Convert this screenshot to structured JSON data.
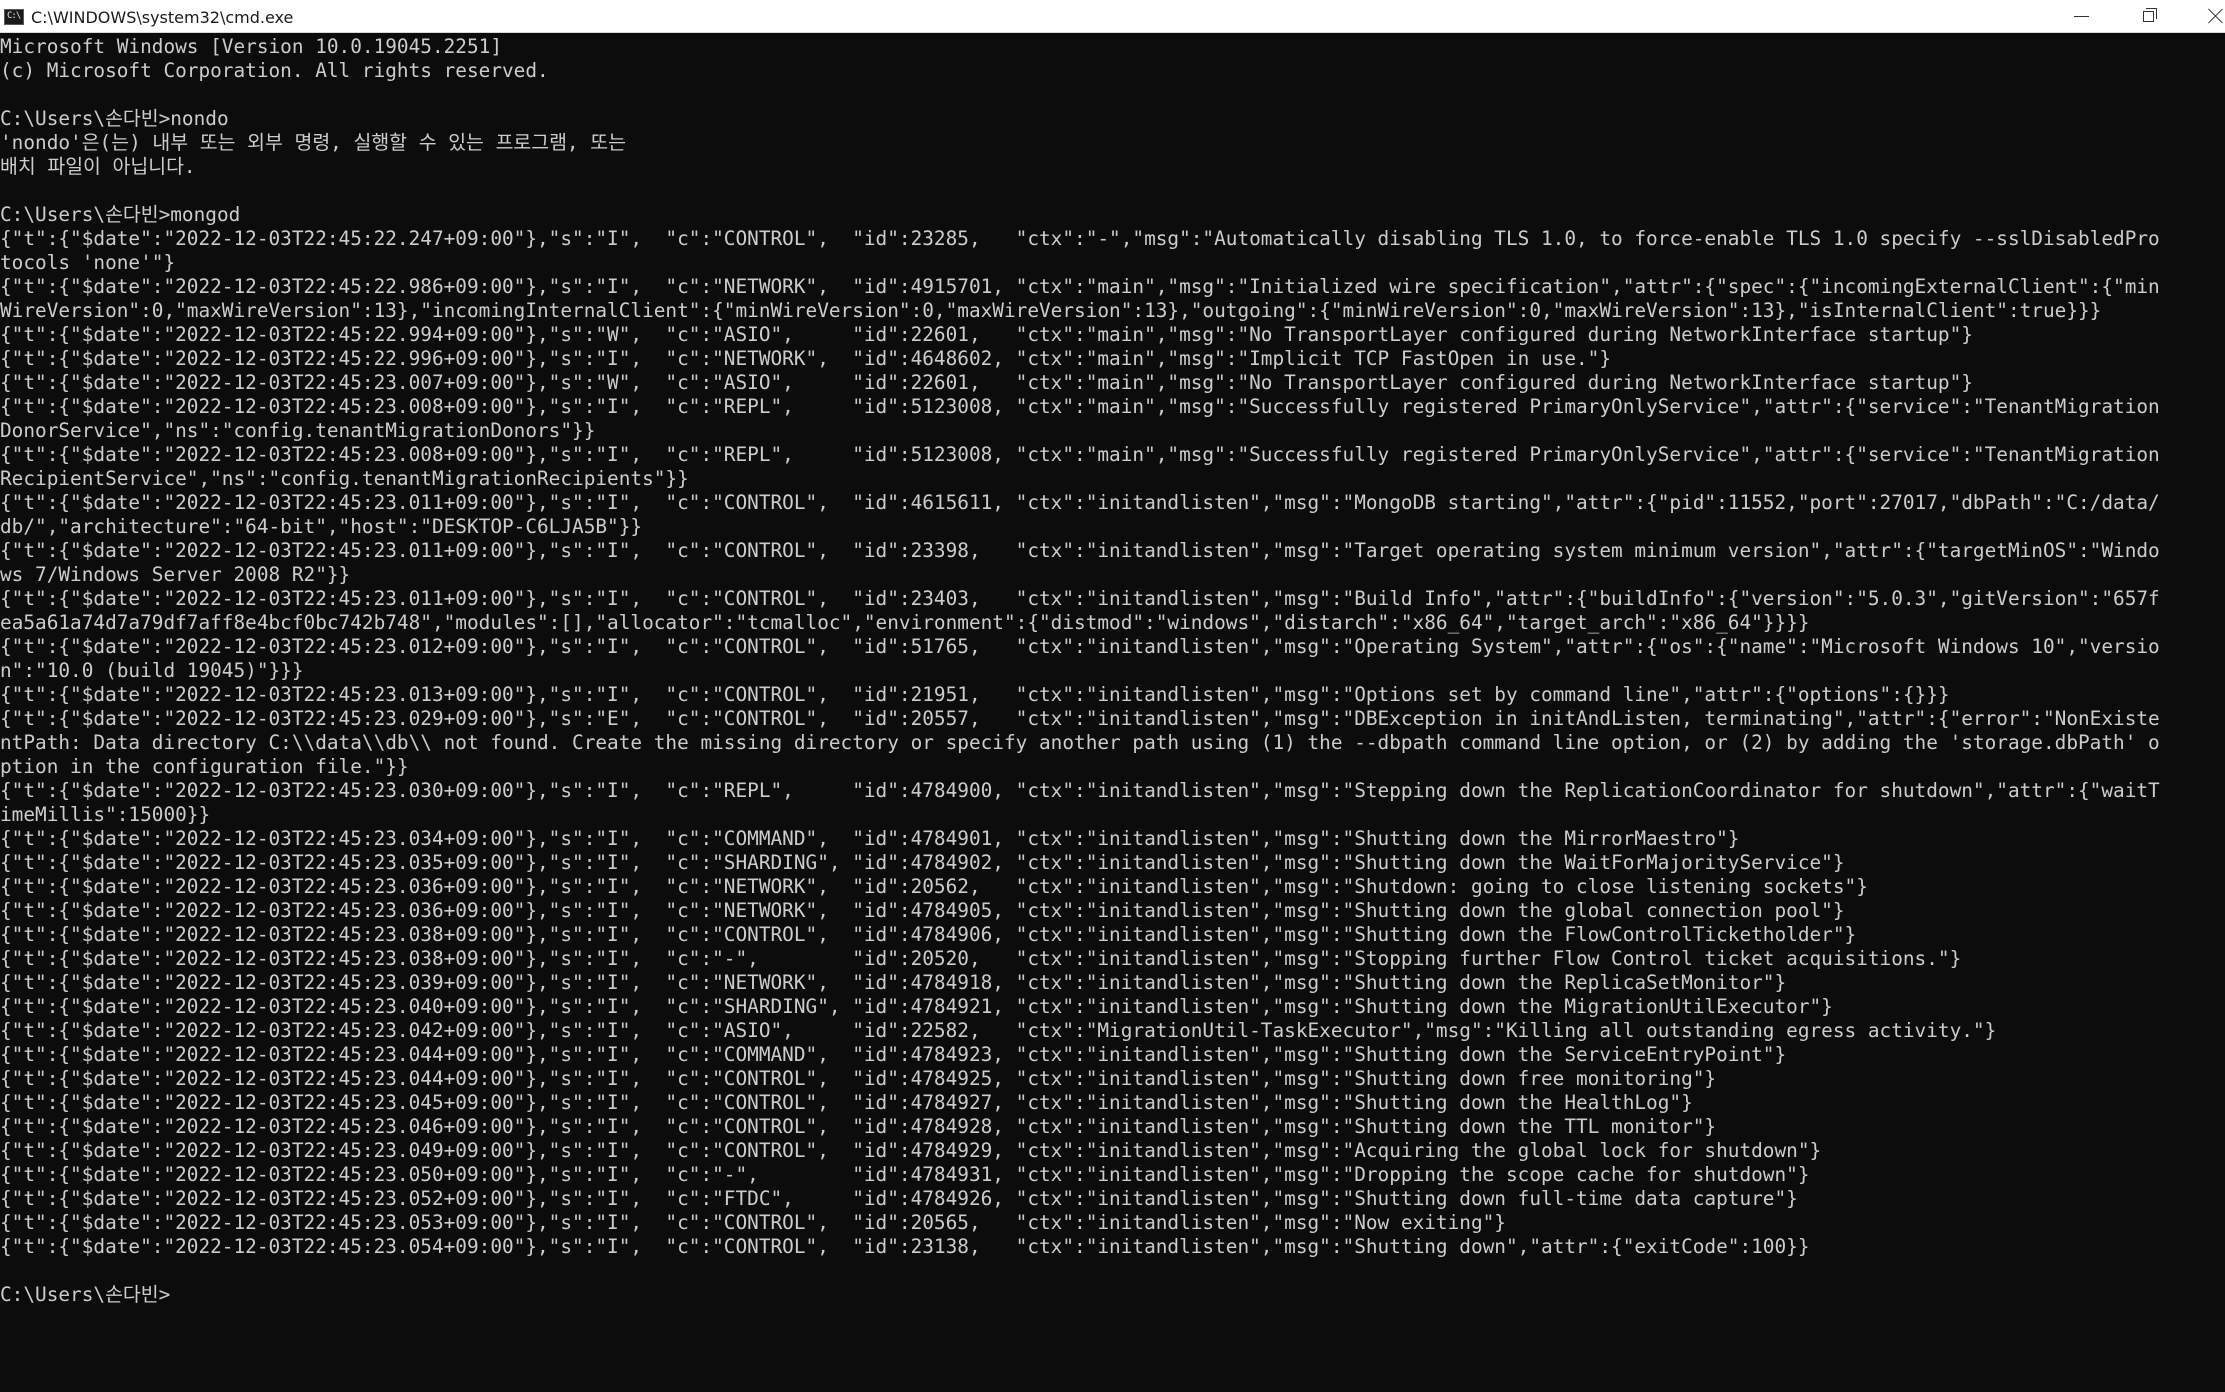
{
  "window": {
    "title": "C:\\WINDOWS\\system32\\cmd.exe",
    "icon_text": "C:\\"
  },
  "controls": {
    "minimize_icon": "minimize-icon",
    "maximize_icon": "restore-icon",
    "close_icon": "close-icon"
  },
  "colors": {
    "background": "#0c0c0c",
    "text": "#cccccc",
    "titlebar": "#ffffff"
  },
  "console": {
    "lines": [
      "Microsoft Windows [Version 10.0.19045.2251]",
      "(c) Microsoft Corporation. All rights reserved.",
      "",
      "C:\\Users\\손다빈>nondo",
      "'nondo'은(는) 내부 또는 외부 명령, 실행할 수 있는 프로그램, 또는",
      "배치 파일이 아닙니다.",
      "",
      "C:\\Users\\손다빈>mongod",
      "{\"t\":{\"$date\":\"2022-12-03T22:45:22.247+09:00\"},\"s\":\"I\",  \"c\":\"CONTROL\",  \"id\":23285,   \"ctx\":\"-\",\"msg\":\"Automatically disabling TLS 1.0, to force-enable TLS 1.0 specify --sslDisabledPro",
      "tocols 'none'\"}",
      "{\"t\":{\"$date\":\"2022-12-03T22:45:22.986+09:00\"},\"s\":\"I\",  \"c\":\"NETWORK\",  \"id\":4915701, \"ctx\":\"main\",\"msg\":\"Initialized wire specification\",\"attr\":{\"spec\":{\"incomingExternalClient\":{\"min",
      "WireVersion\":0,\"maxWireVersion\":13},\"incomingInternalClient\":{\"minWireVersion\":0,\"maxWireVersion\":13},\"outgoing\":{\"minWireVersion\":0,\"maxWireVersion\":13},\"isInternalClient\":true}}}",
      "{\"t\":{\"$date\":\"2022-12-03T22:45:22.994+09:00\"},\"s\":\"W\",  \"c\":\"ASIO\",     \"id\":22601,   \"ctx\":\"main\",\"msg\":\"No TransportLayer configured during NetworkInterface startup\"}",
      "{\"t\":{\"$date\":\"2022-12-03T22:45:22.996+09:00\"},\"s\":\"I\",  \"c\":\"NETWORK\",  \"id\":4648602, \"ctx\":\"main\",\"msg\":\"Implicit TCP FastOpen in use.\"}",
      "{\"t\":{\"$date\":\"2022-12-03T22:45:23.007+09:00\"},\"s\":\"W\",  \"c\":\"ASIO\",     \"id\":22601,   \"ctx\":\"main\",\"msg\":\"No TransportLayer configured during NetworkInterface startup\"}",
      "{\"t\":{\"$date\":\"2022-12-03T22:45:23.008+09:00\"},\"s\":\"I\",  \"c\":\"REPL\",     \"id\":5123008, \"ctx\":\"main\",\"msg\":\"Successfully registered PrimaryOnlyService\",\"attr\":{\"service\":\"TenantMigration",
      "DonorService\",\"ns\":\"config.tenantMigrationDonors\"}}",
      "{\"t\":{\"$date\":\"2022-12-03T22:45:23.008+09:00\"},\"s\":\"I\",  \"c\":\"REPL\",     \"id\":5123008, \"ctx\":\"main\",\"msg\":\"Successfully registered PrimaryOnlyService\",\"attr\":{\"service\":\"TenantMigration",
      "RecipientService\",\"ns\":\"config.tenantMigrationRecipients\"}}",
      "{\"t\":{\"$date\":\"2022-12-03T22:45:23.011+09:00\"},\"s\":\"I\",  \"c\":\"CONTROL\",  \"id\":4615611, \"ctx\":\"initandlisten\",\"msg\":\"MongoDB starting\",\"attr\":{\"pid\":11552,\"port\":27017,\"dbPath\":\"C:/data/",
      "db/\",\"architecture\":\"64-bit\",\"host\":\"DESKTOP-C6LJA5B\"}}",
      "{\"t\":{\"$date\":\"2022-12-03T22:45:23.011+09:00\"},\"s\":\"I\",  \"c\":\"CONTROL\",  \"id\":23398,   \"ctx\":\"initandlisten\",\"msg\":\"Target operating system minimum version\",\"attr\":{\"targetMinOS\":\"Windo",
      "ws 7/Windows Server 2008 R2\"}}",
      "{\"t\":{\"$date\":\"2022-12-03T22:45:23.011+09:00\"},\"s\":\"I\",  \"c\":\"CONTROL\",  \"id\":23403,   \"ctx\":\"initandlisten\",\"msg\":\"Build Info\",\"attr\":{\"buildInfo\":{\"version\":\"5.0.3\",\"gitVersion\":\"657f",
      "ea5a61a74d7a79df7aff8e4bcf0bc742b748\",\"modules\":[],\"allocator\":\"tcmalloc\",\"environment\":{\"distmod\":\"windows\",\"distarch\":\"x86_64\",\"target_arch\":\"x86_64\"}}}}",
      "{\"t\":{\"$date\":\"2022-12-03T22:45:23.012+09:00\"},\"s\":\"I\",  \"c\":\"CONTROL\",  \"id\":51765,   \"ctx\":\"initandlisten\",\"msg\":\"Operating System\",\"attr\":{\"os\":{\"name\":\"Microsoft Windows 10\",\"versio",
      "n\":\"10.0 (build 19045)\"}}}",
      "{\"t\":{\"$date\":\"2022-12-03T22:45:23.013+09:00\"},\"s\":\"I\",  \"c\":\"CONTROL\",  \"id\":21951,   \"ctx\":\"initandlisten\",\"msg\":\"Options set by command line\",\"attr\":{\"options\":{}}}",
      "{\"t\":{\"$date\":\"2022-12-03T22:45:23.029+09:00\"},\"s\":\"E\",  \"c\":\"CONTROL\",  \"id\":20557,   \"ctx\":\"initandlisten\",\"msg\":\"DBException in initAndListen, terminating\",\"attr\":{\"error\":\"NonExiste",
      "ntPath: Data directory C:\\\\data\\\\db\\\\ not found. Create the missing directory or specify another path using (1) the --dbpath command line option, or (2) by adding the 'storage.dbPath' o",
      "ption in the configuration file.\"}}",
      "{\"t\":{\"$date\":\"2022-12-03T22:45:23.030+09:00\"},\"s\":\"I\",  \"c\":\"REPL\",     \"id\":4784900, \"ctx\":\"initandlisten\",\"msg\":\"Stepping down the ReplicationCoordinator for shutdown\",\"attr\":{\"waitT",
      "imeMillis\":15000}}",
      "{\"t\":{\"$date\":\"2022-12-03T22:45:23.034+09:00\"},\"s\":\"I\",  \"c\":\"COMMAND\",  \"id\":4784901, \"ctx\":\"initandlisten\",\"msg\":\"Shutting down the MirrorMaestro\"}",
      "{\"t\":{\"$date\":\"2022-12-03T22:45:23.035+09:00\"},\"s\":\"I\",  \"c\":\"SHARDING\", \"id\":4784902, \"ctx\":\"initandlisten\",\"msg\":\"Shutting down the WaitForMajorityService\"}",
      "{\"t\":{\"$date\":\"2022-12-03T22:45:23.036+09:00\"},\"s\":\"I\",  \"c\":\"NETWORK\",  \"id\":20562,   \"ctx\":\"initandlisten\",\"msg\":\"Shutdown: going to close listening sockets\"}",
      "{\"t\":{\"$date\":\"2022-12-03T22:45:23.036+09:00\"},\"s\":\"I\",  \"c\":\"NETWORK\",  \"id\":4784905, \"ctx\":\"initandlisten\",\"msg\":\"Shutting down the global connection pool\"}",
      "{\"t\":{\"$date\":\"2022-12-03T22:45:23.038+09:00\"},\"s\":\"I\",  \"c\":\"CONTROL\",  \"id\":4784906, \"ctx\":\"initandlisten\",\"msg\":\"Shutting down the FlowControlTicketholder\"}",
      "{\"t\":{\"$date\":\"2022-12-03T22:45:23.038+09:00\"},\"s\":\"I\",  \"c\":\"-\",        \"id\":20520,   \"ctx\":\"initandlisten\",\"msg\":\"Stopping further Flow Control ticket acquisitions.\"}",
      "{\"t\":{\"$date\":\"2022-12-03T22:45:23.039+09:00\"},\"s\":\"I\",  \"c\":\"NETWORK\",  \"id\":4784918, \"ctx\":\"initandlisten\",\"msg\":\"Shutting down the ReplicaSetMonitor\"}",
      "{\"t\":{\"$date\":\"2022-12-03T22:45:23.040+09:00\"},\"s\":\"I\",  \"c\":\"SHARDING\", \"id\":4784921, \"ctx\":\"initandlisten\",\"msg\":\"Shutting down the MigrationUtilExecutor\"}",
      "{\"t\":{\"$date\":\"2022-12-03T22:45:23.042+09:00\"},\"s\":\"I\",  \"c\":\"ASIO\",     \"id\":22582,   \"ctx\":\"MigrationUtil-TaskExecutor\",\"msg\":\"Killing all outstanding egress activity.\"}",
      "{\"t\":{\"$date\":\"2022-12-03T22:45:23.044+09:00\"},\"s\":\"I\",  \"c\":\"COMMAND\",  \"id\":4784923, \"ctx\":\"initandlisten\",\"msg\":\"Shutting down the ServiceEntryPoint\"}",
      "{\"t\":{\"$date\":\"2022-12-03T22:45:23.044+09:00\"},\"s\":\"I\",  \"c\":\"CONTROL\",  \"id\":4784925, \"ctx\":\"initandlisten\",\"msg\":\"Shutting down free monitoring\"}",
      "{\"t\":{\"$date\":\"2022-12-03T22:45:23.045+09:00\"},\"s\":\"I\",  \"c\":\"CONTROL\",  \"id\":4784927, \"ctx\":\"initandlisten\",\"msg\":\"Shutting down the HealthLog\"}",
      "{\"t\":{\"$date\":\"2022-12-03T22:45:23.046+09:00\"},\"s\":\"I\",  \"c\":\"CONTROL\",  \"id\":4784928, \"ctx\":\"initandlisten\",\"msg\":\"Shutting down the TTL monitor\"}",
      "{\"t\":{\"$date\":\"2022-12-03T22:45:23.049+09:00\"},\"s\":\"I\",  \"c\":\"CONTROL\",  \"id\":4784929, \"ctx\":\"initandlisten\",\"msg\":\"Acquiring the global lock for shutdown\"}",
      "{\"t\":{\"$date\":\"2022-12-03T22:45:23.050+09:00\"},\"s\":\"I\",  \"c\":\"-\",        \"id\":4784931, \"ctx\":\"initandlisten\",\"msg\":\"Dropping the scope cache for shutdown\"}",
      "{\"t\":{\"$date\":\"2022-12-03T22:45:23.052+09:00\"},\"s\":\"I\",  \"c\":\"FTDC\",     \"id\":4784926, \"ctx\":\"initandlisten\",\"msg\":\"Shutting down full-time data capture\"}",
      "{\"t\":{\"$date\":\"2022-12-03T22:45:23.053+09:00\"},\"s\":\"I\",  \"c\":\"CONTROL\",  \"id\":20565,   \"ctx\":\"initandlisten\",\"msg\":\"Now exiting\"}",
      "{\"t\":{\"$date\":\"2022-12-03T22:45:23.054+09:00\"},\"s\":\"I\",  \"c\":\"CONTROL\",  \"id\":23138,   \"ctx\":\"initandlisten\",\"msg\":\"Shutting down\",\"attr\":{\"exitCode\":100}}",
      "",
      "C:\\Users\\손다빈>"
    ]
  }
}
